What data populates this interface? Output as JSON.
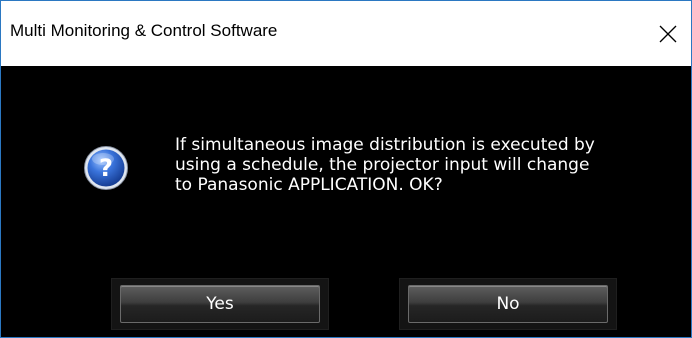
{
  "window": {
    "title": "Multi Monitoring & Control Software"
  },
  "dialog": {
    "icon": "question-icon",
    "message_lines": [
      "If simultaneous image distribution is executed by",
      "using a schedule, the projector input will change",
      "to Panasonic APPLICATION. OK?"
    ],
    "yes_label": "Yes",
    "no_label": "No"
  },
  "colors": {
    "titlebar_bg": "#ffffff",
    "window_border": "#2b78c2",
    "content_bg": "#000000",
    "text": "#ffffff",
    "icon_blue": "#2a5fc4"
  }
}
